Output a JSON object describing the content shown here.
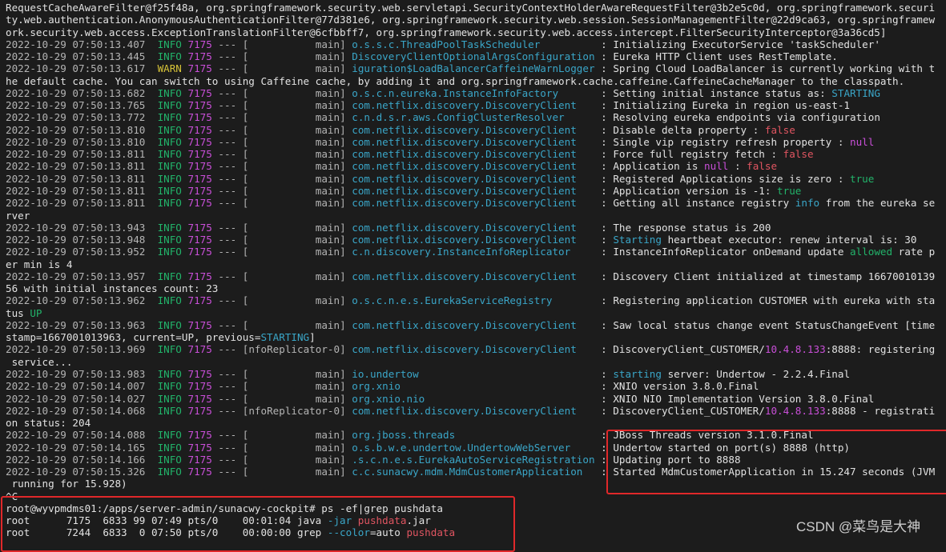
{
  "colors": {
    "background": "#1c1c1c",
    "info": "#22b36a",
    "warn": "#d6c338",
    "pid": "#c94fd8",
    "logger": "#3aa6c8",
    "highlight_box": "#e0282a"
  },
  "watermark": "CSDN @菜鸟是大神",
  "rows": [
    {
      "segments": [
        [
          "RequestCacheAwareFilter@f25f48a, org.springframework.security.web.servletapi.SecurityContextHolderAwareRequestFilter@3b2e5c0d, org.springframework.securi",
          "text"
        ]
      ]
    },
    {
      "segments": [
        [
          "ty.web.authentication.AnonymousAuthenticationFilter@77d381e6, org.springframework.security.web.session.SessionManagementFilter@22d9ca63, org.springframew",
          "text"
        ]
      ]
    },
    {
      "segments": [
        [
          "ork.security.web.access.ExceptionTranslationFilter@6cfbbff7, org.springframework.security.web.access.intercept.FilterSecurityInterceptor@3a36cd5]",
          "text"
        ]
      ]
    },
    {
      "log": {
        "ts": "2022-10-29 07:50:13.407",
        "level": "INFO",
        "pid": "7175",
        "thread": "main",
        "logger": "o.s.s.c.ThreadPoolTaskScheduler"
      },
      "segments": [
        [
          "Initializing ExecutorService 'taskScheduler'",
          "text"
        ]
      ]
    },
    {
      "log": {
        "ts": "2022-10-29 07:50:13.445",
        "level": "INFO",
        "pid": "7175",
        "thread": "main",
        "logger": "DiscoveryClientOptionalArgsConfiguration"
      },
      "segments": [
        [
          "Eureka HTTP Client uses RestTemplate.",
          "text"
        ]
      ]
    },
    {
      "log": {
        "ts": "2022-10-29 07:50:13.617",
        "level": "WARN",
        "pid": "7175",
        "thread": "main",
        "logger": "iguration$LoadBalancerCaffeineWarnLogger"
      },
      "segments": [
        [
          "Spring Cloud LoadBalancer is currently working with t",
          "text"
        ]
      ]
    },
    {
      "segments": [
        [
          "he default cache. You can switch to using Caffeine cache, by adding it and org.springframework.cache.caffeine.CaffeineCacheManager to the classpath.",
          "text"
        ]
      ]
    },
    {
      "log": {
        "ts": "2022-10-29 07:50:13.682",
        "level": "INFO",
        "pid": "7175",
        "thread": "main",
        "logger": "o.s.c.n.eureka.InstanceInfoFactory"
      },
      "segments": [
        [
          "Setting initial instance status as: ",
          "text"
        ],
        [
          "STARTING",
          "cyan"
        ]
      ]
    },
    {
      "log": {
        "ts": "2022-10-29 07:50:13.765",
        "level": "INFO",
        "pid": "7175",
        "thread": "main",
        "logger": "com.netflix.discovery.DiscoveryClient"
      },
      "segments": [
        [
          "Initializing Eureka in region us-east-1",
          "text"
        ]
      ]
    },
    {
      "log": {
        "ts": "2022-10-29 07:50:13.772",
        "level": "INFO",
        "pid": "7175",
        "thread": "main",
        "logger": "c.n.d.s.r.aws.ConfigClusterResolver"
      },
      "segments": [
        [
          "Resolving eureka endpoints via configuration",
          "text"
        ]
      ]
    },
    {
      "log": {
        "ts": "2022-10-29 07:50:13.810",
        "level": "INFO",
        "pid": "7175",
        "thread": "main",
        "logger": "com.netflix.discovery.DiscoveryClient"
      },
      "segments": [
        [
          "Disable delta property : ",
          "text"
        ],
        [
          "false",
          "red"
        ]
      ]
    },
    {
      "log": {
        "ts": "2022-10-29 07:50:13.810",
        "level": "INFO",
        "pid": "7175",
        "thread": "main",
        "logger": "com.netflix.discovery.DiscoveryClient"
      },
      "segments": [
        [
          "Single vip registry refresh property : ",
          "text"
        ],
        [
          "null",
          "magenta"
        ]
      ]
    },
    {
      "log": {
        "ts": "2022-10-29 07:50:13.811",
        "level": "INFO",
        "pid": "7175",
        "thread": "main",
        "logger": "com.netflix.discovery.DiscoveryClient"
      },
      "segments": [
        [
          "Force full registry fetch : ",
          "text"
        ],
        [
          "false",
          "red"
        ]
      ]
    },
    {
      "log": {
        "ts": "2022-10-29 07:50:13.811",
        "level": "INFO",
        "pid": "7175",
        "thread": "main",
        "logger": "com.netflix.discovery.DiscoveryClient"
      },
      "segments": [
        [
          "Application is ",
          "text"
        ],
        [
          "null",
          "magenta"
        ],
        [
          " : ",
          "text"
        ],
        [
          "false",
          "red"
        ]
      ]
    },
    {
      "log": {
        "ts": "2022-10-29 07:50:13.811",
        "level": "INFO",
        "pid": "7175",
        "thread": "main",
        "logger": "com.netflix.discovery.DiscoveryClient"
      },
      "segments": [
        [
          "Registered Applications size is zero : ",
          "text"
        ],
        [
          "true",
          "green"
        ]
      ]
    },
    {
      "log": {
        "ts": "2022-10-29 07:50:13.811",
        "level": "INFO",
        "pid": "7175",
        "thread": "main",
        "logger": "com.netflix.discovery.DiscoveryClient"
      },
      "segments": [
        [
          "Application version is -1: ",
          "text"
        ],
        [
          "true",
          "green"
        ]
      ]
    },
    {
      "log": {
        "ts": "2022-10-29 07:50:13.811",
        "level": "INFO",
        "pid": "7175",
        "thread": "main",
        "logger": "com.netflix.discovery.DiscoveryClient"
      },
      "segments": [
        [
          "Getting all instance registry ",
          "text"
        ],
        [
          "info",
          "cyan"
        ],
        [
          " from the eureka se",
          "text"
        ]
      ]
    },
    {
      "segments": [
        [
          "rver",
          "text"
        ]
      ]
    },
    {
      "log": {
        "ts": "2022-10-29 07:50:13.943",
        "level": "INFO",
        "pid": "7175",
        "thread": "main",
        "logger": "com.netflix.discovery.DiscoveryClient"
      },
      "segments": [
        [
          "The response status is 200",
          "text"
        ]
      ]
    },
    {
      "log": {
        "ts": "2022-10-29 07:50:13.948",
        "level": "INFO",
        "pid": "7175",
        "thread": "main",
        "logger": "com.netflix.discovery.DiscoveryClient"
      },
      "segments": [
        [
          "Starting",
          "cyan"
        ],
        [
          " heartbeat executor: renew interval is: 30",
          "text"
        ]
      ]
    },
    {
      "log": {
        "ts": "2022-10-29 07:50:13.952",
        "level": "INFO",
        "pid": "7175",
        "thread": "main",
        "logger": "c.n.discovery.InstanceInfoReplicator"
      },
      "segments": [
        [
          "InstanceInfoReplicator onDemand update ",
          "text"
        ],
        [
          "allowed",
          "green"
        ],
        [
          " rate p",
          "text"
        ]
      ]
    },
    {
      "segments": [
        [
          "er min is 4",
          "text"
        ]
      ]
    },
    {
      "log": {
        "ts": "2022-10-29 07:50:13.957",
        "level": "INFO",
        "pid": "7175",
        "thread": "main",
        "logger": "com.netflix.discovery.DiscoveryClient"
      },
      "segments": [
        [
          "Discovery Client initialized at timestamp 16670010139",
          "text"
        ]
      ]
    },
    {
      "segments": [
        [
          "56 with initial instances count: 23",
          "text"
        ]
      ]
    },
    {
      "log": {
        "ts": "2022-10-29 07:50:13.962",
        "level": "INFO",
        "pid": "7175",
        "thread": "main",
        "logger": "o.s.c.n.e.s.EurekaServiceRegistry"
      },
      "segments": [
        [
          "Registering application CUSTOMER with eureka with sta",
          "text"
        ]
      ]
    },
    {
      "segments": [
        [
          "tus ",
          "text"
        ],
        [
          "UP",
          "green"
        ]
      ]
    },
    {
      "log": {
        "ts": "2022-10-29 07:50:13.963",
        "level": "INFO",
        "pid": "7175",
        "thread": "main",
        "logger": "com.netflix.discovery.DiscoveryClient"
      },
      "segments": [
        [
          "Saw local status change event StatusChangeEvent [time",
          "text"
        ]
      ]
    },
    {
      "segments": [
        [
          "stamp=1667001013963, current=UP, previous=",
          "text"
        ],
        [
          "STARTING",
          "cyan"
        ],
        [
          "]",
          "text"
        ]
      ]
    },
    {
      "log": {
        "ts": "2022-10-29 07:50:13.969",
        "level": "INFO",
        "pid": "7175",
        "thread": "nfoReplicator-0",
        "logger": "com.netflix.discovery.DiscoveryClient"
      },
      "segments": [
        [
          "DiscoveryClient_CUSTOMER/",
          "text"
        ],
        [
          "10.4.8.133",
          "magenta"
        ],
        [
          ":8888: registering",
          "text"
        ]
      ]
    },
    {
      "segments": [
        [
          " service...",
          "text"
        ]
      ]
    },
    {
      "log": {
        "ts": "2022-10-29 07:50:13.983",
        "level": "INFO",
        "pid": "7175",
        "thread": "main",
        "logger": "io.undertow"
      },
      "segments": [
        [
          "starting",
          "cyan"
        ],
        [
          " server: Undertow - 2.2.4.Final",
          "text"
        ]
      ]
    },
    {
      "log": {
        "ts": "2022-10-29 07:50:14.007",
        "level": "INFO",
        "pid": "7175",
        "thread": "main",
        "logger": "org.xnio"
      },
      "segments": [
        [
          "XNIO version 3.8.0.Final",
          "text"
        ]
      ]
    },
    {
      "log": {
        "ts": "2022-10-29 07:50:14.027",
        "level": "INFO",
        "pid": "7175",
        "thread": "main",
        "logger": "org.xnio.nio"
      },
      "segments": [
        [
          "XNIO NIO Implementation Version 3.8.0.Final",
          "text"
        ]
      ]
    },
    {
      "log": {
        "ts": "2022-10-29 07:50:14.068",
        "level": "INFO",
        "pid": "7175",
        "thread": "nfoReplicator-0",
        "logger": "com.netflix.discovery.DiscoveryClient"
      },
      "segments": [
        [
          "DiscoveryClient_CUSTOMER/",
          "text"
        ],
        [
          "10.4.8.133",
          "magenta"
        ],
        [
          ":8888 - registrati",
          "text"
        ]
      ]
    },
    {
      "segments": [
        [
          "on status: 204",
          "text"
        ]
      ]
    },
    {
      "log": {
        "ts": "2022-10-29 07:50:14.088",
        "level": "INFO",
        "pid": "7175",
        "thread": "main",
        "logger": "org.jboss.threads"
      },
      "segments": [
        [
          "JBoss Threads version 3.1.0.Final",
          "text"
        ]
      ]
    },
    {
      "log": {
        "ts": "2022-10-29 07:50:14.165",
        "level": "INFO",
        "pid": "7175",
        "thread": "main",
        "logger": "o.s.b.w.e.undertow.UndertowWebServer"
      },
      "segments": [
        [
          "Undertow started on port(s) 8888 (http)",
          "text"
        ]
      ]
    },
    {
      "log": {
        "ts": "2022-10-29 07:50:14.166",
        "level": "INFO",
        "pid": "7175",
        "thread": "main",
        "logger": ".s.c.n.e.s.EurekaAutoServiceRegistration"
      },
      "segments": [
        [
          "Updating port to 8888",
          "text"
        ]
      ]
    },
    {
      "log": {
        "ts": "2022-10-29 07:50:15.326",
        "level": "INFO",
        "pid": "7175",
        "thread": "main",
        "logger": "c.c.sunacwy.mdm.MdmCustomerApplication"
      },
      "segments": [
        [
          "Started MdmCustomerApplication in 15.247 seconds (JVM",
          "text"
        ]
      ]
    },
    {
      "segments": [
        [
          " running for 15.928)",
          "text"
        ]
      ]
    },
    {
      "segments": [
        [
          "^C",
          "text"
        ]
      ]
    },
    {
      "segments": [
        [
          "root@wyvpmdms01:/apps/server-admin/sunacwy-cockpit# ps -ef|grep pushdata",
          "text"
        ]
      ]
    },
    {
      "segments": [
        [
          "root      7175  6833 99 07:49 pts/0    00:01:04 java ",
          "text"
        ],
        [
          "-jar",
          "cyan"
        ],
        [
          " ",
          "text"
        ],
        [
          "pushdata",
          "red"
        ],
        [
          ".jar",
          "text"
        ]
      ]
    },
    {
      "segments": [
        [
          "root      7244  6833  0 07:50 pts/0    00:00:00 grep ",
          "text"
        ],
        [
          "--color",
          "cyan"
        ],
        [
          "=auto ",
          "text"
        ],
        [
          "pushdata",
          "red"
        ]
      ]
    }
  ]
}
